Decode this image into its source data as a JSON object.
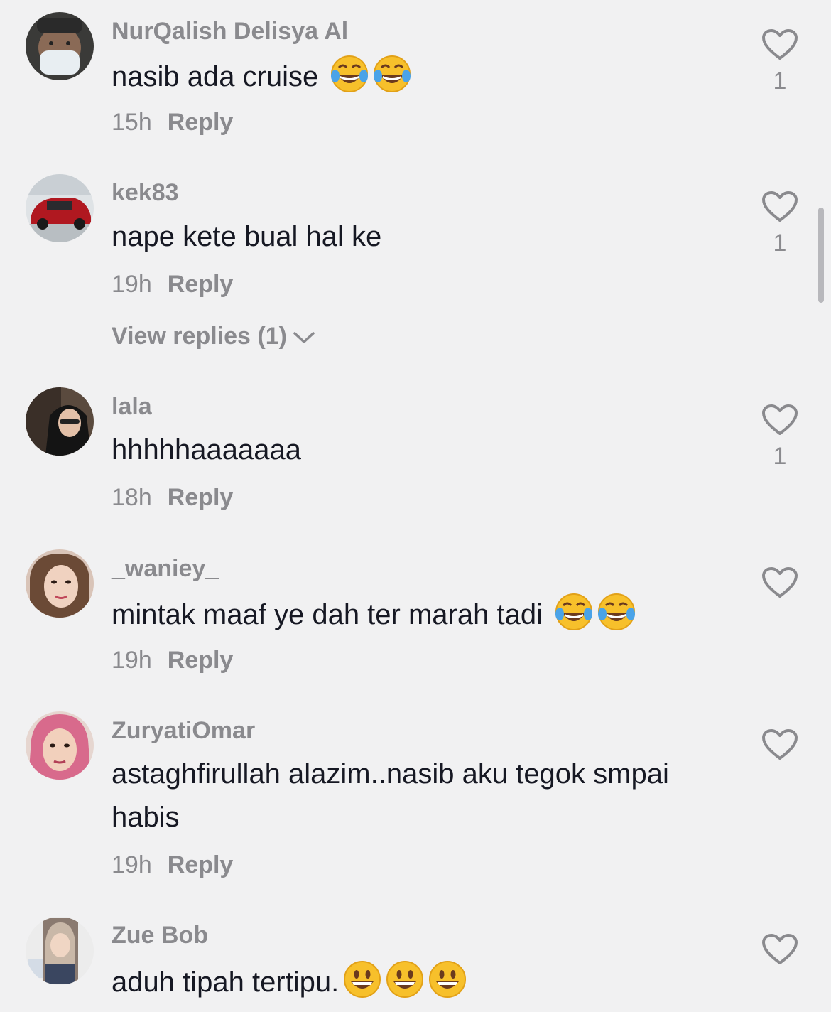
{
  "colors": {
    "background": "#f1f1f2",
    "username": "#8a8a8e",
    "text": "#161823",
    "meta": "#8a8a8e",
    "heart_outline": "#8a8a8e"
  },
  "comments": [
    {
      "username": "NurQalish Delisya Al",
      "text": "nasib ada cruise",
      "emojis": [
        "face-with-tears-of-joy",
        "face-with-tears-of-joy"
      ],
      "time": "15h",
      "reply_label": "Reply",
      "likes": "1"
    },
    {
      "username": "kek83",
      "text": "nape kete bual hal ke",
      "emojis": [],
      "time": "19h",
      "reply_label": "Reply",
      "likes": "1",
      "view_replies": "View replies (1)"
    },
    {
      "username": "lala",
      "text": "hhhhhaaaaaaa",
      "emojis": [],
      "time": "18h",
      "reply_label": "Reply",
      "likes": "1"
    },
    {
      "username": "_waniey_",
      "text": "mintak maaf ye dah ter marah tadi",
      "emojis": [
        "face-with-tears-of-joy",
        "face-with-tears-of-joy"
      ],
      "time": "19h",
      "reply_label": "Reply",
      "likes": ""
    },
    {
      "username": "ZuryatiOmar",
      "text": "astaghfirullah alazim..nasib aku tegok smpai habis",
      "emojis": [],
      "time": "19h",
      "reply_label": "Reply",
      "likes": ""
    },
    {
      "username": "Zue Bob",
      "text": "aduh tipah tertipu.",
      "emojis": [
        "grinning-face-with-big-eyes",
        "grinning-face-with-big-eyes",
        "grinning-face-with-big-eyes"
      ],
      "time": "",
      "reply_label": "",
      "likes": ""
    }
  ]
}
